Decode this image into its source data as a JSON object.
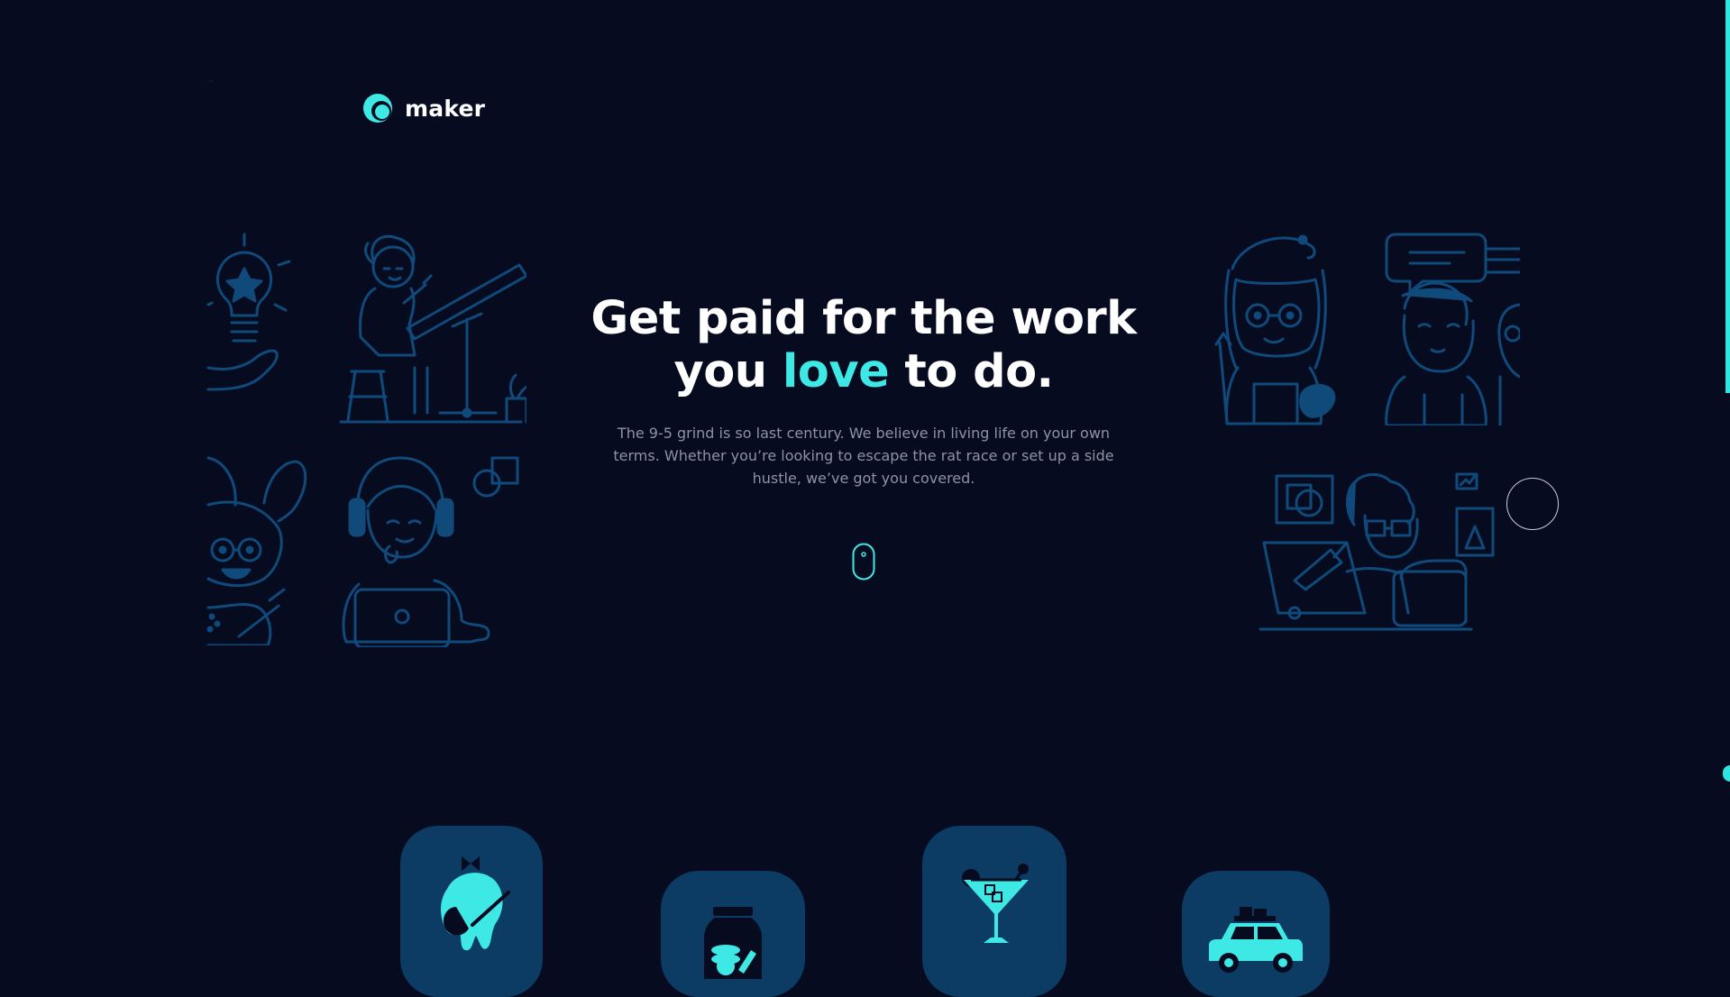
{
  "brand": {
    "name": "maker"
  },
  "hero": {
    "headline_part1": "Get paid for the work",
    "headline_part2_pre": "you ",
    "headline_accent": "love",
    "headline_part2_post": " to do.",
    "description": "The 9-5 grind is so last century. We believe in living life on your own terms. Whether you’re looking to escape the rat race or set up a side hustle, we’ve got you covered."
  },
  "colors": {
    "background": "#070b1f",
    "accent": "#3ee9e5",
    "illustration_stroke": "#0f4a7a",
    "card_bg": "#0c3b63",
    "text_muted": "#8c93a3"
  },
  "illustrations": [
    "lightbulb-star-icon",
    "drafting-woman-illustration",
    "bunny-ears-girl-illustration",
    "headphones-laptop-woman-illustration",
    "artist-beret-woman-illustration",
    "chat-man-illustration",
    "designer-tablet-man-illustration"
  ],
  "cards": [
    {
      "icon": "paint-palette-icon"
    },
    {
      "icon": "coin-jar-icon"
    },
    {
      "icon": "cocktail-glass-icon"
    },
    {
      "icon": "car-roof-luggage-icon"
    }
  ]
}
